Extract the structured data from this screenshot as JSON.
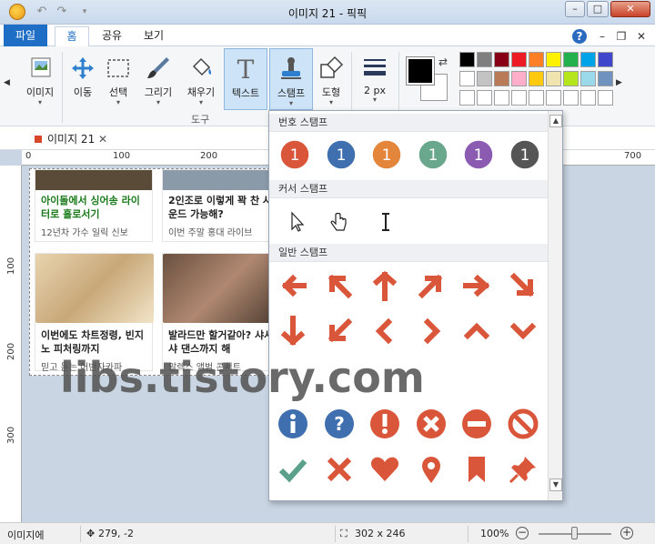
{
  "window": {
    "title": "이미지 21 - 픽픽",
    "minimize": "–",
    "maximize": "□",
    "close": "✕"
  },
  "quick_access": {
    "undo": "↶",
    "redo": "↷",
    "menu": "▾"
  },
  "tabs": {
    "file": "파일",
    "home": "홈",
    "share": "공유",
    "view": "보기"
  },
  "ribbon_controls": {
    "help": "?",
    "minimize": "–",
    "restore": "❐",
    "close": "✕"
  },
  "ribbon": {
    "image": "이미지",
    "move": "이동",
    "select": "선택",
    "draw": "그리기",
    "fill": "채우기",
    "text": "텍스트",
    "stamp": "스탬프",
    "shape": "도형",
    "line_width": "2 px",
    "group_label": "도구"
  },
  "palette": [
    "#000000",
    "#7f7f7f",
    "#880015",
    "#ed1c24",
    "#ff7f27",
    "#fff200",
    "#22b14c",
    "#00a2e8",
    "#3f48cc",
    "#ffffff",
    "#c3c3c3",
    "#b97a57",
    "#ffaec9",
    "#ffc90e",
    "#efe4b0",
    "#b5e61d",
    "#99d9ea",
    "#7092be",
    "#ffffff",
    "#ffffff",
    "#ffffff",
    "#ffffff",
    "#ffffff",
    "#ffffff",
    "#ffffff",
    "#ffffff",
    "#ffffff"
  ],
  "document_tab": {
    "label": "이미지 21"
  },
  "ruler": {
    "h": [
      "0",
      "100",
      "200",
      "700"
    ],
    "v": [
      "100",
      "200",
      "300"
    ]
  },
  "canvas_cards": [
    {
      "headline": "아이돌에서 싱어송 라이터로 홀로서기",
      "sub": "12년차 가수 일릭 신보"
    },
    {
      "headline": "2인조로 이렇게 꽉 찬 사운드 가능해?",
      "sub": "이번 주말 홍대 라이브"
    },
    {
      "headline": "이번에도 차트정령, 빈지노 피처링까지",
      "sub": "믿고 듣는 어반자카파"
    },
    {
      "headline": "발라드만 할거같아? 샤샤샤 댄스까지 해",
      "sub": "알렉스 앨범 콘서트"
    }
  ],
  "stamp_panel": {
    "number_stamps": "번호 스탬프",
    "cursor_stamps": "커서 스탬프",
    "general_stamps": "일반 스탬프",
    "number_values": [
      "1",
      "1",
      "1",
      "1",
      "1",
      "1"
    ],
    "number_colors": [
      "#d9563a",
      "#3f6fae",
      "#e3853b",
      "#6aa88e",
      "#8a5bb0",
      "#555555"
    ],
    "cursor_icons": [
      "arrow-cursor-icon",
      "hand-cursor-icon",
      "ibeam-cursor-icon"
    ],
    "arrow_icons": [
      "arrow-left-icon",
      "arrow-up-left-icon",
      "arrow-up-icon",
      "arrow-up-right-icon",
      "arrow-right-icon",
      "arrow-down-right-icon",
      "arrow-down-icon",
      "arrow-down-left-icon",
      "chevron-left-icon",
      "chevron-right-icon",
      "chevron-up-icon",
      "chevron-down-icon"
    ],
    "symbol_icons": [
      "info-icon",
      "question-icon",
      "exclamation-icon",
      "x-circle-icon",
      "minus-circle-icon",
      "no-icon"
    ],
    "bottom_icons": [
      "check-icon",
      "x-icon",
      "heart-icon",
      "pin-icon",
      "bookmark-icon",
      "pushpin-icon"
    ]
  },
  "watermark": "libs.tistory.com",
  "status": {
    "left": "이미지에",
    "cursor_pos": "279, -2",
    "size": "302 x 246",
    "zoom": "100%",
    "zoom_minus": "−",
    "zoom_plus": "+"
  }
}
